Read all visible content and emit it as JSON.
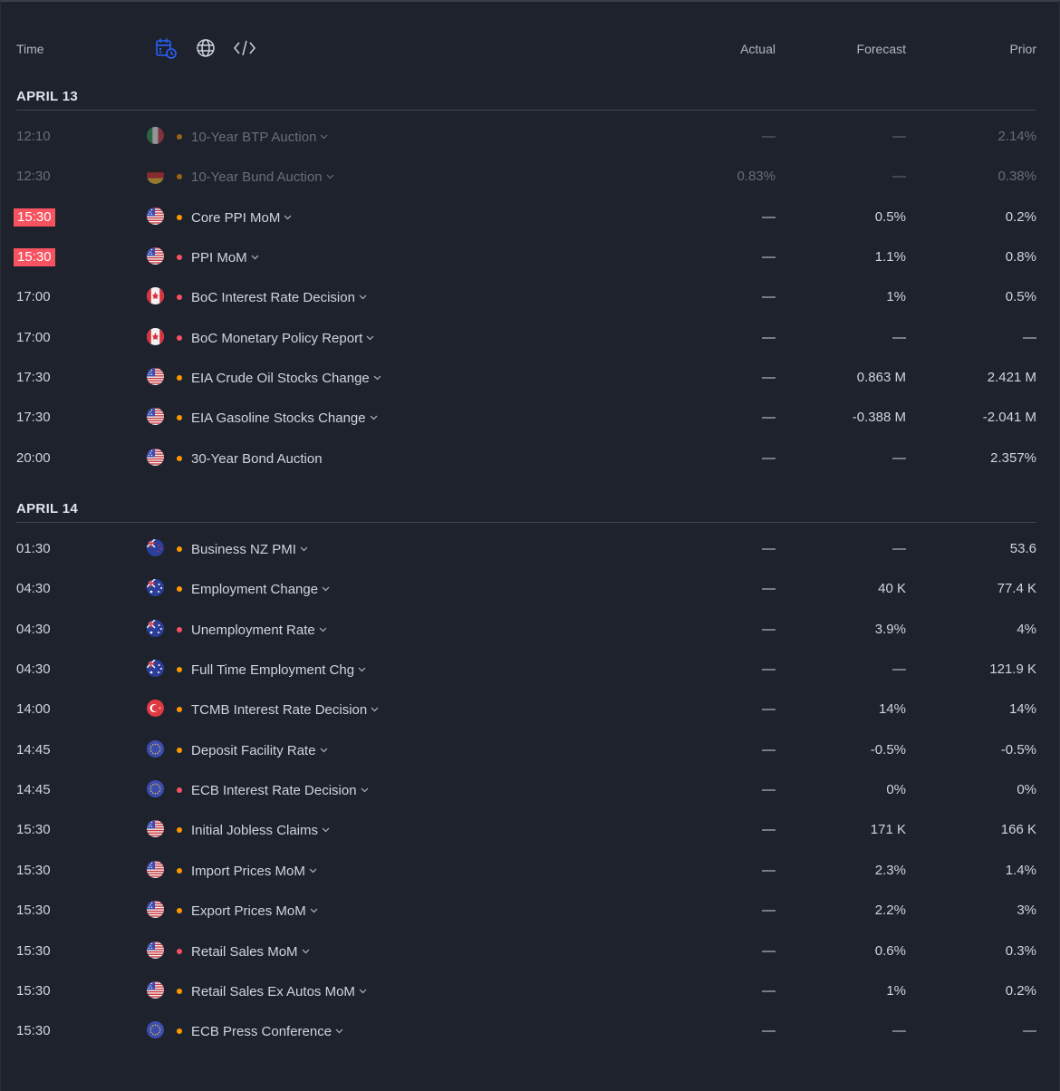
{
  "header": {
    "time_label": "Time",
    "actual_label": "Actual",
    "forecast_label": "Forecast",
    "prior_label": "Prior",
    "icons": [
      "calendar-clock-icon",
      "globe-icon",
      "code-icon"
    ],
    "accent": "#2962ff"
  },
  "colors": {
    "highlight": "#f7525f",
    "importance_medium": "#ff9800",
    "importance_high": "#f7525f"
  },
  "sections": [
    {
      "label": "APRIL 13",
      "rows": [
        {
          "time": "12:10",
          "flag": "it",
          "importance": "medium",
          "event": "10-Year BTP Auction",
          "actual": "—",
          "forecast": "—",
          "prior": "2.14%",
          "dim": true
        },
        {
          "time": "12:30",
          "flag": "de",
          "importance": "medium",
          "event": "10-Year Bund Auction",
          "actual": "0.83%",
          "forecast": "—",
          "prior": "0.38%",
          "dim": true
        },
        {
          "time": "15:30",
          "flag": "us",
          "importance": "medium",
          "event": "Core PPI MoM",
          "actual": "—",
          "forecast": "0.5%",
          "prior": "0.2%",
          "highlight": true
        },
        {
          "time": "15:30",
          "flag": "us",
          "importance": "high",
          "event": "PPI MoM",
          "actual": "—",
          "forecast": "1.1%",
          "prior": "0.8%",
          "highlight": true
        },
        {
          "time": "17:00",
          "flag": "ca",
          "importance": "high",
          "event": "BoC Interest Rate Decision",
          "actual": "—",
          "forecast": "1%",
          "prior": "0.5%"
        },
        {
          "time": "17:00",
          "flag": "ca",
          "importance": "high",
          "event": "BoC Monetary Policy Report",
          "actual": "—",
          "forecast": "—",
          "prior": "—"
        },
        {
          "time": "17:30",
          "flag": "us",
          "importance": "medium",
          "event": "EIA Crude Oil Stocks Change",
          "actual": "—",
          "forecast": "0.863 M",
          "prior": "2.421 M"
        },
        {
          "time": "17:30",
          "flag": "us",
          "importance": "medium",
          "event": "EIA Gasoline Stocks Change",
          "actual": "—",
          "forecast": "-0.388 M",
          "prior": "-2.041 M"
        },
        {
          "time": "20:00",
          "flag": "us",
          "importance": "medium",
          "event": "30-Year Bond Auction",
          "actual": "—",
          "forecast": "—",
          "prior": "2.357%",
          "no_chevron": true
        }
      ]
    },
    {
      "label": "APRIL 14",
      "rows": [
        {
          "time": "01:30",
          "flag": "nz",
          "importance": "medium",
          "event": "Business NZ PMI",
          "actual": "—",
          "forecast": "—",
          "prior": "53.6"
        },
        {
          "time": "04:30",
          "flag": "au",
          "importance": "medium",
          "event": "Employment Change",
          "actual": "—",
          "forecast": "40 K",
          "prior": "77.4 K"
        },
        {
          "time": "04:30",
          "flag": "au",
          "importance": "high",
          "event": "Unemployment Rate",
          "actual": "—",
          "forecast": "3.9%",
          "prior": "4%"
        },
        {
          "time": "04:30",
          "flag": "au",
          "importance": "medium",
          "event": "Full Time Employment Chg",
          "actual": "—",
          "forecast": "—",
          "prior": "121.9 K"
        },
        {
          "time": "14:00",
          "flag": "tr",
          "importance": "medium",
          "event": "TCMB Interest Rate Decision",
          "actual": "—",
          "forecast": "14%",
          "prior": "14%"
        },
        {
          "time": "14:45",
          "flag": "eu",
          "importance": "medium",
          "event": "Deposit Facility Rate",
          "actual": "—",
          "forecast": "-0.5%",
          "prior": "-0.5%"
        },
        {
          "time": "14:45",
          "flag": "eu",
          "importance": "high",
          "event": "ECB Interest Rate Decision",
          "actual": "—",
          "forecast": "0%",
          "prior": "0%"
        },
        {
          "time": "15:30",
          "flag": "us",
          "importance": "medium",
          "event": "Initial Jobless Claims",
          "actual": "—",
          "forecast": "171 K",
          "prior": "166 K"
        },
        {
          "time": "15:30",
          "flag": "us",
          "importance": "medium",
          "event": "Import Prices MoM",
          "actual": "—",
          "forecast": "2.3%",
          "prior": "1.4%"
        },
        {
          "time": "15:30",
          "flag": "us",
          "importance": "medium",
          "event": "Export Prices MoM",
          "actual": "—",
          "forecast": "2.2%",
          "prior": "3%"
        },
        {
          "time": "15:30",
          "flag": "us",
          "importance": "high",
          "event": "Retail Sales MoM",
          "actual": "—",
          "forecast": "0.6%",
          "prior": "0.3%"
        },
        {
          "time": "15:30",
          "flag": "us",
          "importance": "medium",
          "event": "Retail Sales Ex Autos MoM",
          "actual": "—",
          "forecast": "1%",
          "prior": "0.2%"
        },
        {
          "time": "15:30",
          "flag": "eu",
          "importance": "medium",
          "event": "ECB Press Conference",
          "actual": "—",
          "forecast": "—",
          "prior": "—"
        }
      ]
    }
  ]
}
